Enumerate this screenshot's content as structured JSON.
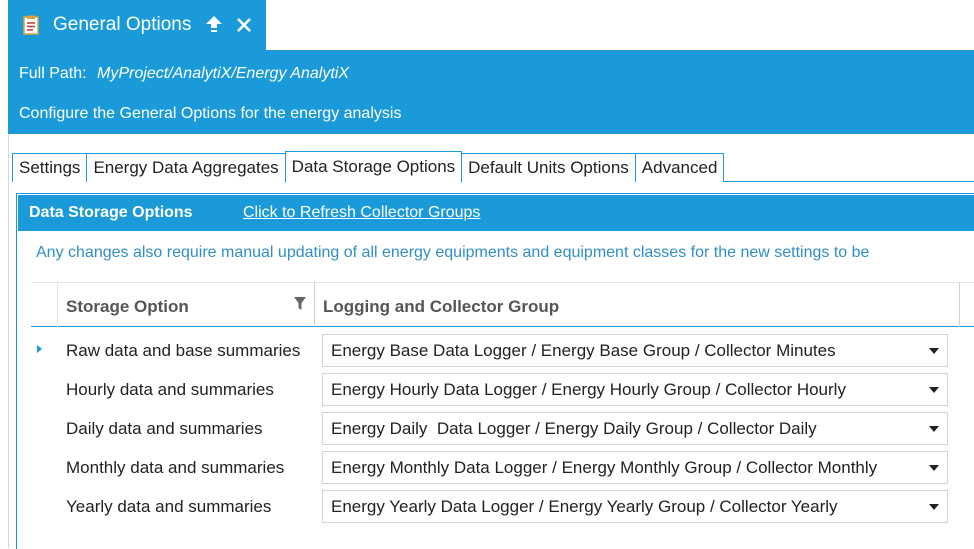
{
  "window": {
    "title": "General Options",
    "full_path_label": "Full Path:",
    "full_path_value": "MyProject/AnalytiX/Energy AnalytiX",
    "description": "Configure the General Options for the energy analysis"
  },
  "tabs": [
    {
      "label": "Settings"
    },
    {
      "label": "Energy Data Aggregates"
    },
    {
      "label": "Data Storage Options",
      "active": true
    },
    {
      "label": "Default Units Options"
    },
    {
      "label": "Advanced"
    }
  ],
  "section": {
    "title": "Data Storage Options",
    "refresh_link": "Click to Refresh Collector Groups",
    "notice": "Any changes also require manual updating of all energy equipments and equipment classes for the new settings to be"
  },
  "grid": {
    "headers": {
      "storage": "Storage Option",
      "logging": "Logging and Collector Group"
    },
    "rows": [
      {
        "storage": "Raw data and base summaries",
        "logging": "Energy Base Data Logger / Energy Base Group / Collector Minutes",
        "current": true
      },
      {
        "storage": "Hourly data and summaries",
        "logging": "Energy Hourly Data Logger / Energy Hourly Group / Collector Hourly"
      },
      {
        "storage": "Daily data and summaries",
        "logging": "Energy Daily  Data Logger / Energy Daily Group / Collector Daily"
      },
      {
        "storage": "Monthly data and summaries",
        "logging": "Energy Monthly Data Logger / Energy Monthly Group / Collector Monthly"
      },
      {
        "storage": "Yearly data and summaries",
        "logging": "Energy Yearly Data Logger / Energy Yearly Group / Collector Yearly"
      }
    ]
  },
  "colors": {
    "accent": "#1a9ad9",
    "notice": "#2f8fc4"
  }
}
